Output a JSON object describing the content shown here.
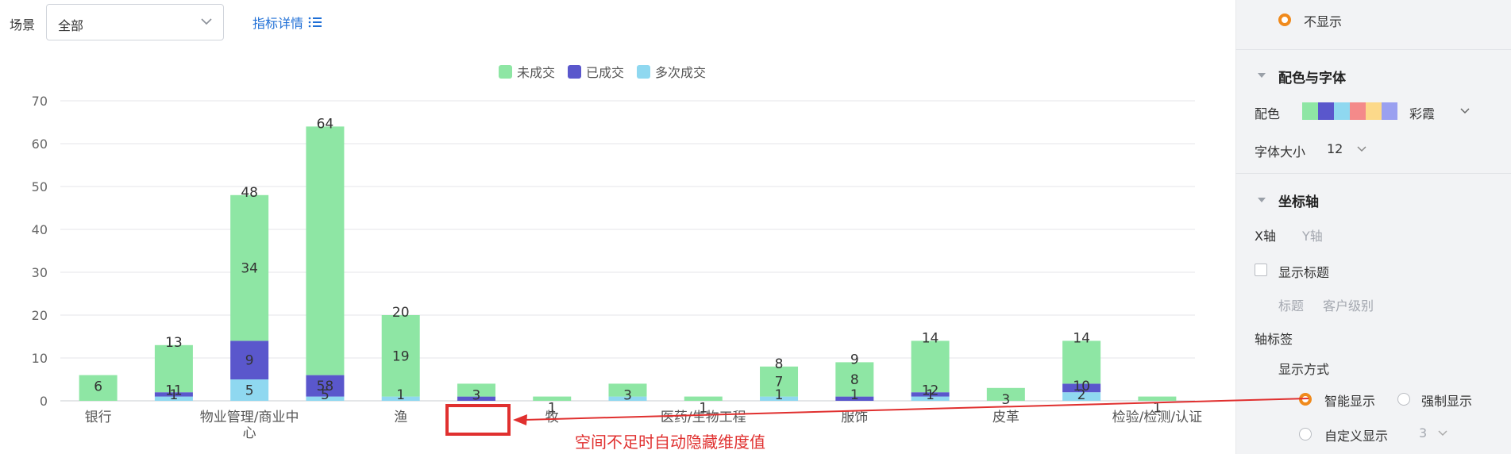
{
  "toolbar": {
    "scene_label": "场景",
    "scene_value": "全部",
    "indicator_link": "指标详情",
    "link_color": "#1f6fd6"
  },
  "chart_data": {
    "type": "bar",
    "stacked": true,
    "legend": [
      {
        "name": "未成交",
        "color": "#8ee6a4"
      },
      {
        "name": "已成交",
        "color": "#5a57cc"
      },
      {
        "name": "多次成交",
        "color": "#8fd8f0"
      }
    ],
    "legend_position": "top-center",
    "ylim": [
      0,
      70
    ],
    "yticks": [
      0,
      10,
      20,
      30,
      40,
      50,
      60,
      70
    ],
    "grid": true,
    "categories": [
      "银行",
      "",
      "物业管理/商业中心",
      "",
      "渔",
      "",
      "牧",
      "",
      "医药/生物工程",
      "",
      "服饰",
      "",
      "皮革",
      "",
      "检验/检测/认证"
    ],
    "series": [
      {
        "name": "未成交",
        "values": [
          6,
          11,
          34,
          58,
          19,
          3,
          1,
          3,
          1,
          7,
          8,
          12,
          3,
          10,
          1
        ]
      },
      {
        "name": "已成交",
        "values": [
          0,
          1,
          9,
          5,
          0,
          1,
          0,
          0,
          0,
          0,
          1,
          1,
          0,
          2,
          0
        ]
      },
      {
        "name": "多次成交",
        "values": [
          0,
          1,
          5,
          1,
          1,
          0,
          0,
          1,
          0,
          1,
          0,
          1,
          0,
          2,
          0
        ]
      }
    ],
    "totals": [
      6,
      13,
      48,
      64,
      20,
      4,
      1,
      4,
      1,
      8,
      9,
      14,
      3,
      14,
      1
    ],
    "segment_labels": [
      [
        "6"
      ],
      [
        "1",
        "11",
        "13"
      ],
      [
        "5",
        "9",
        "34",
        "48"
      ],
      [
        "5",
        "58",
        "64"
      ],
      [
        "1",
        "19",
        "20"
      ],
      [
        "3"
      ],
      [
        "1"
      ],
      [
        "3"
      ],
      [
        "1"
      ],
      [
        "1",
        "7",
        "8"
      ],
      [
        "1",
        "8",
        "9"
      ],
      [
        "1",
        "12",
        "14"
      ],
      [
        "3"
      ],
      [
        "2",
        "10",
        "14"
      ],
      [
        "1"
      ]
    ]
  },
  "annotation": {
    "text": "空间不足时自动隐藏维度值",
    "color": "#e0302f"
  },
  "panel": {
    "hide_label": "不显示",
    "color_section": "配色与字体",
    "color_label": "配色",
    "palette": [
      "#8ee6a4",
      "#5a57cc",
      "#8fd8f0",
      "#f48a8a",
      "#fcd98a",
      "#9aa0f0"
    ],
    "palette_name": "彩霞",
    "font_size_label": "字体大小",
    "font_size_value": "12",
    "axis_section": "坐标轴",
    "x_axis_tab": "X轴",
    "y_axis_tab": "Y轴",
    "show_title_label": "显示标题",
    "title_label": "标题",
    "title_value": "客户级别",
    "axis_tick_label": "轴标签",
    "display_mode_label": "显示方式",
    "smart_display": "智能显示",
    "force_display": "强制显示",
    "custom_display": "自定义显示",
    "custom_value": "3",
    "accent": "#f08a1c"
  }
}
